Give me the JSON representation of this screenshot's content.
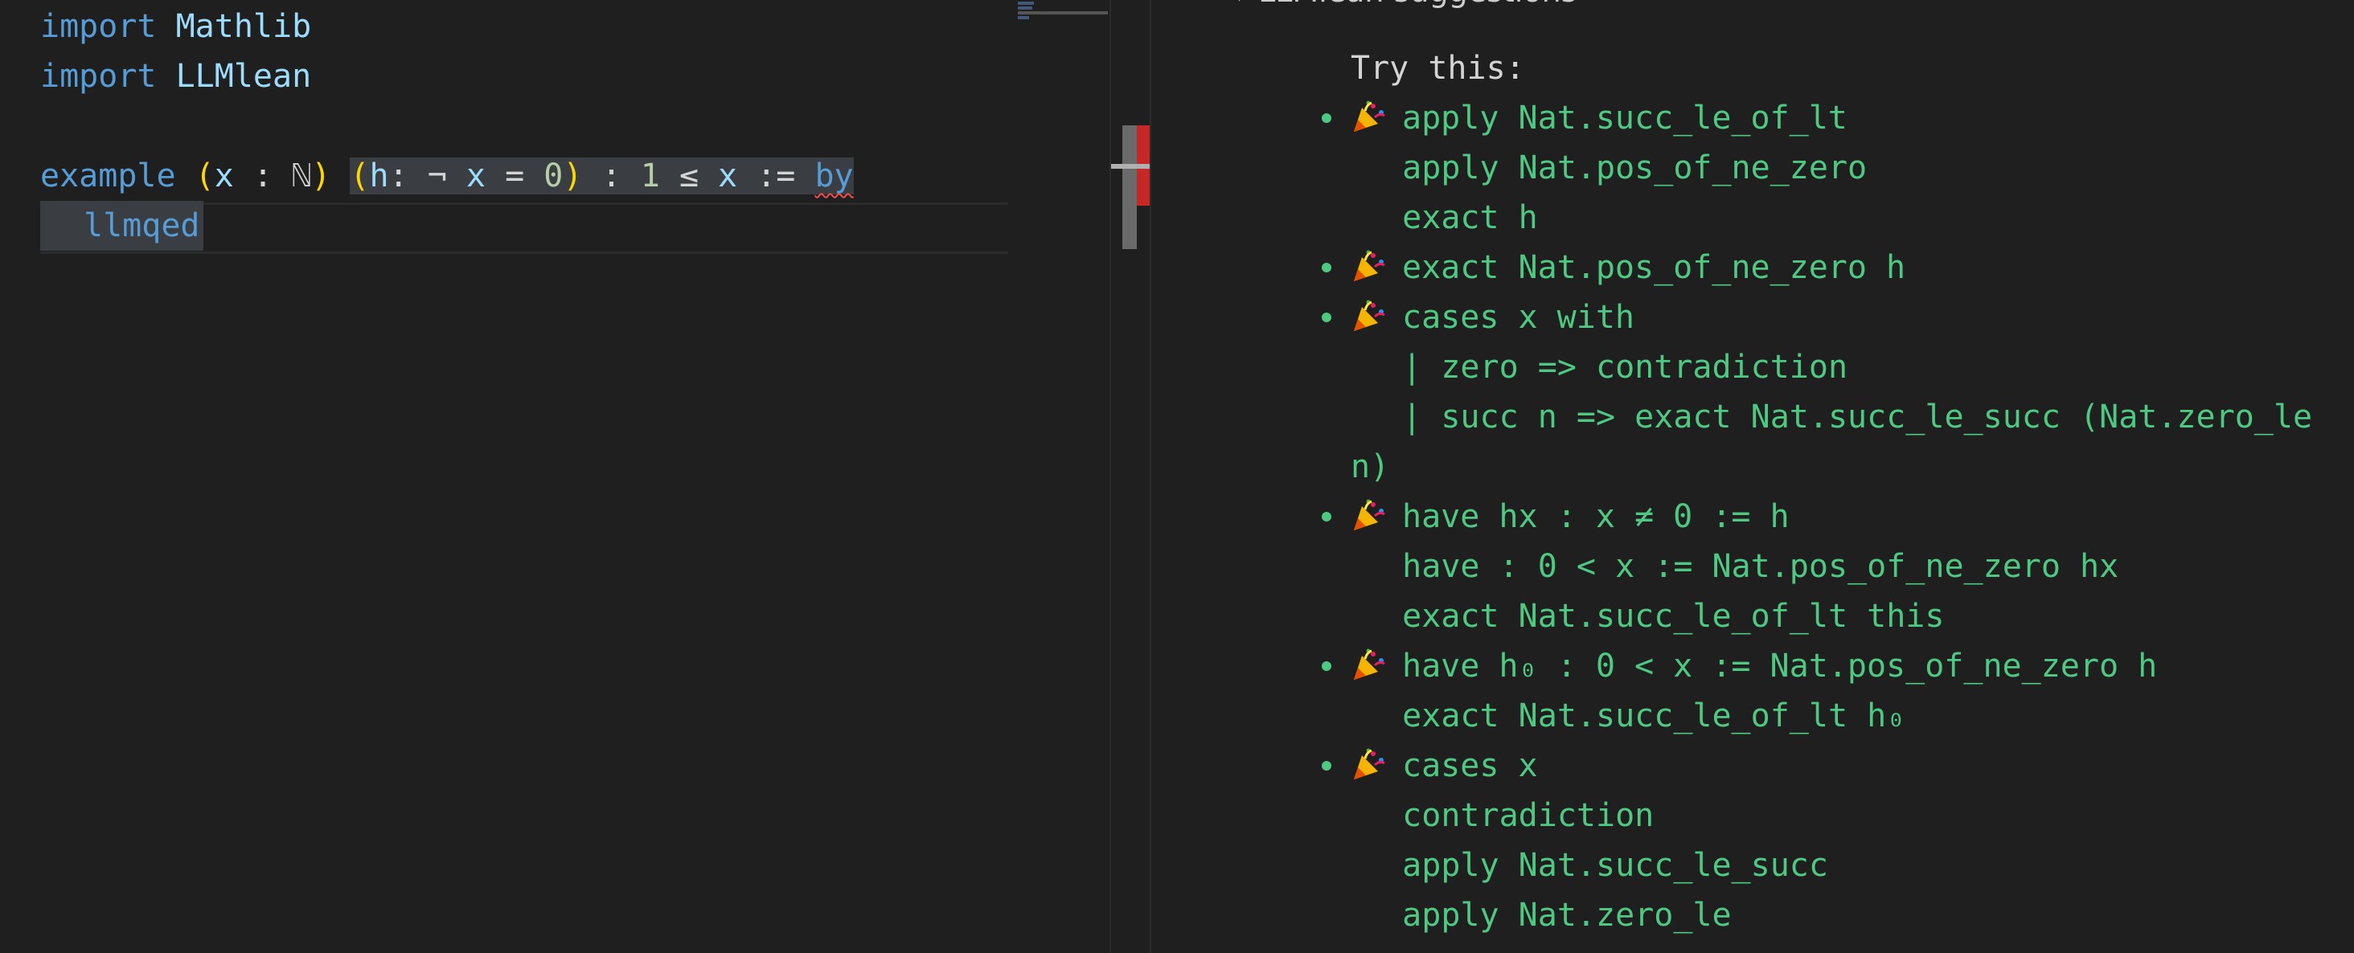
{
  "editor": {
    "lines": [
      {
        "keyword": "import",
        "name": "Mathlib"
      },
      {
        "keyword": "import",
        "name": "LLMlean"
      }
    ],
    "example": {
      "keyword": "example",
      "lparen1": "(",
      "var": "x",
      "colon1": " : ",
      "type": "ℕ",
      "rparen1": ")",
      "lparen2": "(",
      "hyp": "h",
      "hyp_rest": ": ¬ ",
      "x2": "x",
      "eq": " = ",
      "zero": "0",
      "rparen2": ")",
      "colon2": " : ",
      "one": "1",
      "le": " ≤ ",
      "x3": "x",
      "assign": " := ",
      "by": "by"
    },
    "tactic": "llmqed"
  },
  "infoview": {
    "section_title": "LLMlean suggestions",
    "try_this": "Try this:",
    "suggestions": [
      {
        "lines": [
          "apply Nat.succ_le_of_lt",
          "  apply Nat.pos_of_ne_zero",
          "  exact h"
        ]
      },
      {
        "lines": [
          "exact Nat.pos_of_ne_zero h"
        ]
      },
      {
        "lines": [
          "cases x with",
          "  | zero => contradiction",
          "  | succ n => exact Nat.succ_le_succ (Nat.zero_le",
          "n)"
        ]
      },
      {
        "lines": [
          "have hx : x ≠ 0 := h",
          "  have : 0 < x := Nat.pos_of_ne_zero hx",
          "  exact Nat.succ_le_of_lt this"
        ]
      },
      {
        "lines": [
          "have h₀ : 0 < x := Nat.pos_of_ne_zero h",
          "  exact Nat.succ_le_of_lt h₀"
        ]
      },
      {
        "lines": [
          "cases x",
          "  contradiction",
          "  apply Nat.succ_le_succ",
          "  apply Nat.zero_le"
        ]
      }
    ]
  },
  "colors": {
    "keyword": "#569cd6",
    "identifier": "#9cdcfe",
    "paren": "#ffd700",
    "number": "#b5cea8",
    "suggestion": "#4ec982",
    "error": "#c62828"
  }
}
